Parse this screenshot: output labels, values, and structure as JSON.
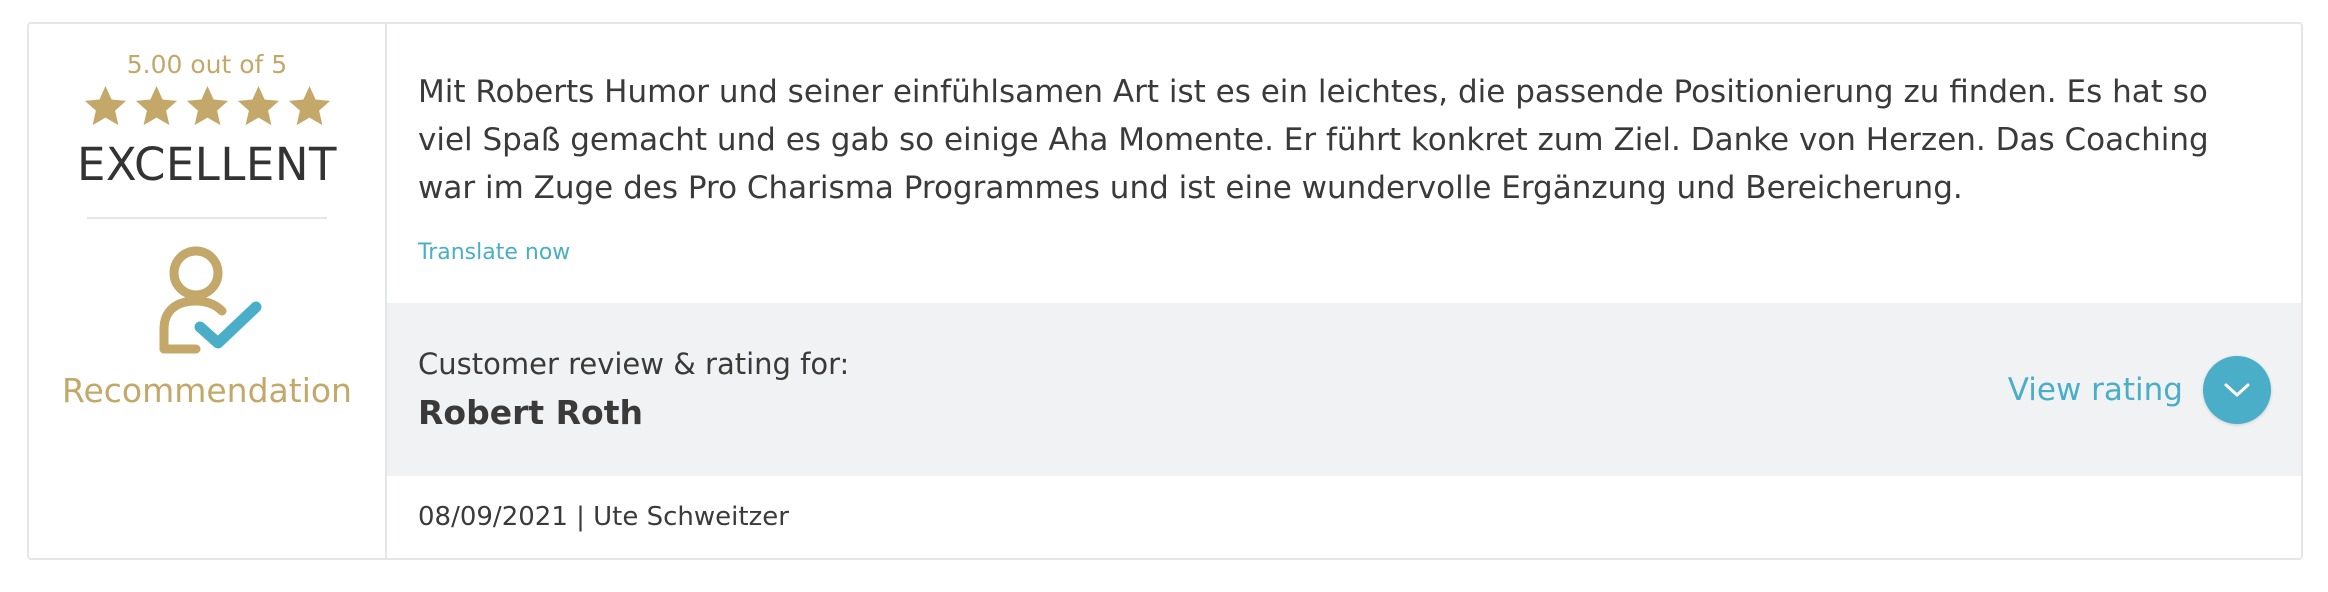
{
  "rating": {
    "score_text": "5.00 out of 5",
    "stars": 5,
    "grade": "EXCELLENT",
    "recommendation": "Recommendation"
  },
  "review": {
    "text": "Mit Roberts Humor und seiner einfühlsamen Art ist es ein leichtes, die passende Positionierung zu finden. Es hat so viel Spaß gemacht und es gab so einige Aha Momente. Er führt konkret zum Ziel. Danke von Herzen. Das Coaching war im Zuge des Pro Charisma Programmes und ist eine wundervolle Ergänzung und Bereicherung.",
    "translate_link": "Translate now"
  },
  "subject": {
    "label": "Customer review & rating for:",
    "name": "Robert Roth",
    "view_rating": "View rating"
  },
  "meta": {
    "date_author": "08/09/2021 | Ute Schweitzer"
  },
  "colors": {
    "gold": "#c3a86a",
    "accent": "#4aaec8",
    "band_bg": "#f1f2f4",
    "border": "#e4e6e9"
  },
  "icons": [
    "star-icon",
    "user-check-icon",
    "chevron-down-icon"
  ]
}
